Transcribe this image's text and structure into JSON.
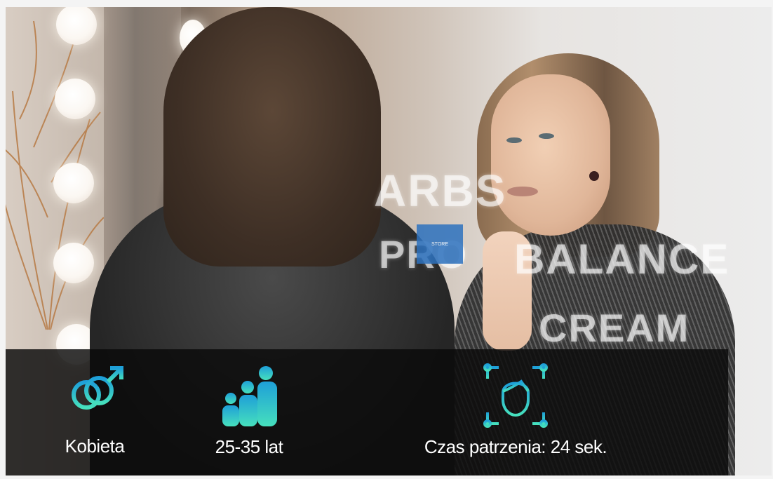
{
  "scene": {
    "hologram_texts": [
      "ARBS",
      "PRO",
      "BALANCE",
      "CREAM"
    ],
    "badge_text": "STORE"
  },
  "stats": {
    "gender": {
      "icon": "gender-icon",
      "label": "Kobieta"
    },
    "age": {
      "icon": "age-group-icon",
      "label": "25-35 lat"
    },
    "watch_time": {
      "icon": "face-scan-icon",
      "label": "Czas patrzenia: 24 sek."
    }
  },
  "colors": {
    "icon_gradient_top": "#1e9fd8",
    "icon_gradient_bottom": "#46e0bd",
    "overlay": "#0a0a0a",
    "text": "#ffffff"
  }
}
